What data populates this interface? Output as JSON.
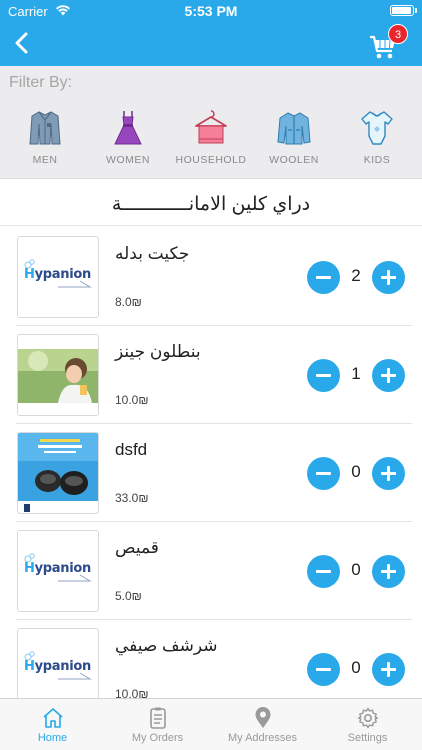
{
  "status_bar": {
    "carrier": "Carrier",
    "time": "5:53 PM"
  },
  "header": {
    "cart_count": "3"
  },
  "filter": {
    "label": "Filter By:",
    "categories": [
      {
        "label": "MEN",
        "icon": "shirt-icon"
      },
      {
        "label": "WOMEN",
        "icon": "dress-icon"
      },
      {
        "label": "HOUSEHOLD",
        "icon": "hanger-towel-icon"
      },
      {
        "label": "WOOLEN",
        "icon": "jacket-icon"
      },
      {
        "label": "KIDS",
        "icon": "onesie-icon"
      }
    ]
  },
  "store": {
    "title": "دراي كلين الامانــــــــــــة"
  },
  "products": [
    {
      "name": "جكيت بدله",
      "price": "8.0₪",
      "qty": "2",
      "image": "hypanion-logo"
    },
    {
      "name": "بنطلون جينز",
      "price": "10.0₪",
      "qty": "1",
      "image": "woman-photo"
    },
    {
      "name": "dsfd",
      "price": "33.0₪",
      "qty": "0",
      "image": "appliance-ad"
    },
    {
      "name": "قميص",
      "price": "5.0₪",
      "qty": "0",
      "image": "hypanion-logo"
    },
    {
      "name": "شرشف صيفي",
      "price": "10.0₪",
      "qty": "0",
      "image": "hypanion-logo"
    }
  ],
  "brand": {
    "logo_text_h": "H",
    "logo_text_rest": "ypanion"
  },
  "tabs": [
    {
      "label": "Home",
      "icon": "home-icon",
      "active": true
    },
    {
      "label": "My Orders",
      "icon": "orders-icon",
      "active": false
    },
    {
      "label": "My Addresses",
      "icon": "location-pin-icon",
      "active": false
    },
    {
      "label": "Settings",
      "icon": "gear-icon",
      "active": false
    }
  ],
  "colors": {
    "accent": "#29a9e9",
    "badge": "#e8262c",
    "filter_bg": "#ececee"
  }
}
